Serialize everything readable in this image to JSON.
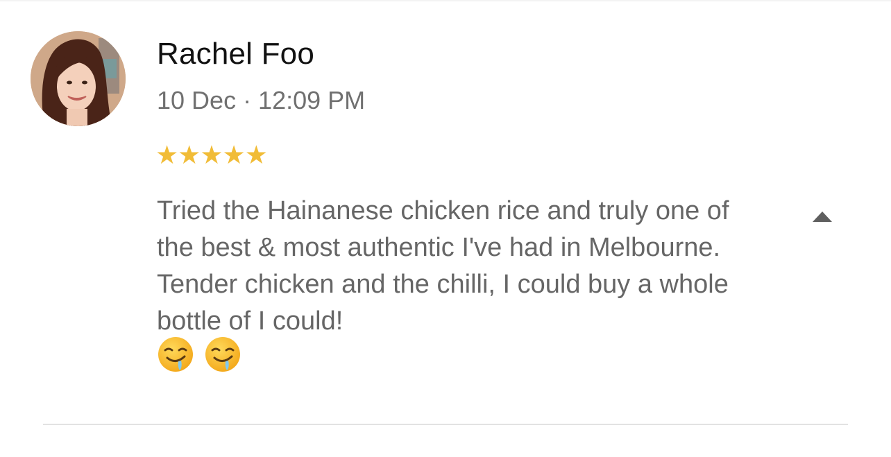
{
  "review": {
    "reviewer_name": "Rachel Foo",
    "date_time": "10 Dec · 12:09 PM",
    "rating": 5,
    "rating_max": 5,
    "star_glyph": "★",
    "text": "Tried the Hainanese chicken rice and truly one of the best & most authentic I've had in Melbourne. Tender chicken and the chilli, I could buy a whole bottle of I could!",
    "emojis": [
      "drooling-face-icon",
      "drooling-face-icon"
    ]
  },
  "icons": {
    "collapse": "caret-up-icon"
  },
  "colors": {
    "star": "#f1bc37",
    "name": "#111111",
    "meta": "#707070",
    "body_text": "#666666",
    "divider": "#e2e2e2"
  }
}
